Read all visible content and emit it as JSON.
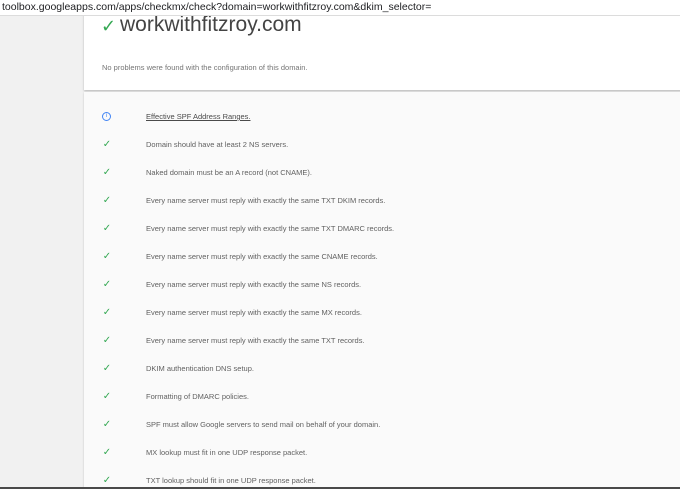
{
  "browser": {
    "url": "toolbox.googleapps.com/apps/checkmx/check?domain=workwithfitzroy.com&dkim_selector="
  },
  "summary": {
    "domain": "workwithfitzroy.com",
    "status_text": "No problems were found with the configuration of this domain."
  },
  "checks": [
    {
      "icon": "info-icon",
      "label": "Effective SPF Address Ranges.",
      "link": true
    },
    {
      "icon": "check-icon",
      "label": "Domain should have at least 2 NS servers."
    },
    {
      "icon": "check-icon",
      "label": "Naked domain must be an A record (not CNAME)."
    },
    {
      "icon": "check-icon",
      "label": "Every name server must reply with exactly the same TXT DKIM records."
    },
    {
      "icon": "check-icon",
      "label": "Every name server must reply with exactly the same TXT DMARC records."
    },
    {
      "icon": "check-icon",
      "label": "Every name server must reply with exactly the same CNAME records."
    },
    {
      "icon": "check-icon",
      "label": "Every name server must reply with exactly the same NS records."
    },
    {
      "icon": "check-icon",
      "label": "Every name server must reply with exactly the same MX records."
    },
    {
      "icon": "check-icon",
      "label": "Every name server must reply with exactly the same TXT records."
    },
    {
      "icon": "check-icon",
      "label": "DKIM authentication DNS setup."
    },
    {
      "icon": "check-icon",
      "label": "Formatting of DMARC policies."
    },
    {
      "icon": "check-icon",
      "label": "SPF must allow Google servers to send mail on behalf of your domain."
    },
    {
      "icon": "check-icon",
      "label": "MX lookup must fit in one UDP response packet."
    },
    {
      "icon": "check-icon",
      "label": "TXT lookup should fit in one UDP response packet."
    }
  ],
  "colors": {
    "success": "#34a853",
    "info": "#4285f4"
  }
}
